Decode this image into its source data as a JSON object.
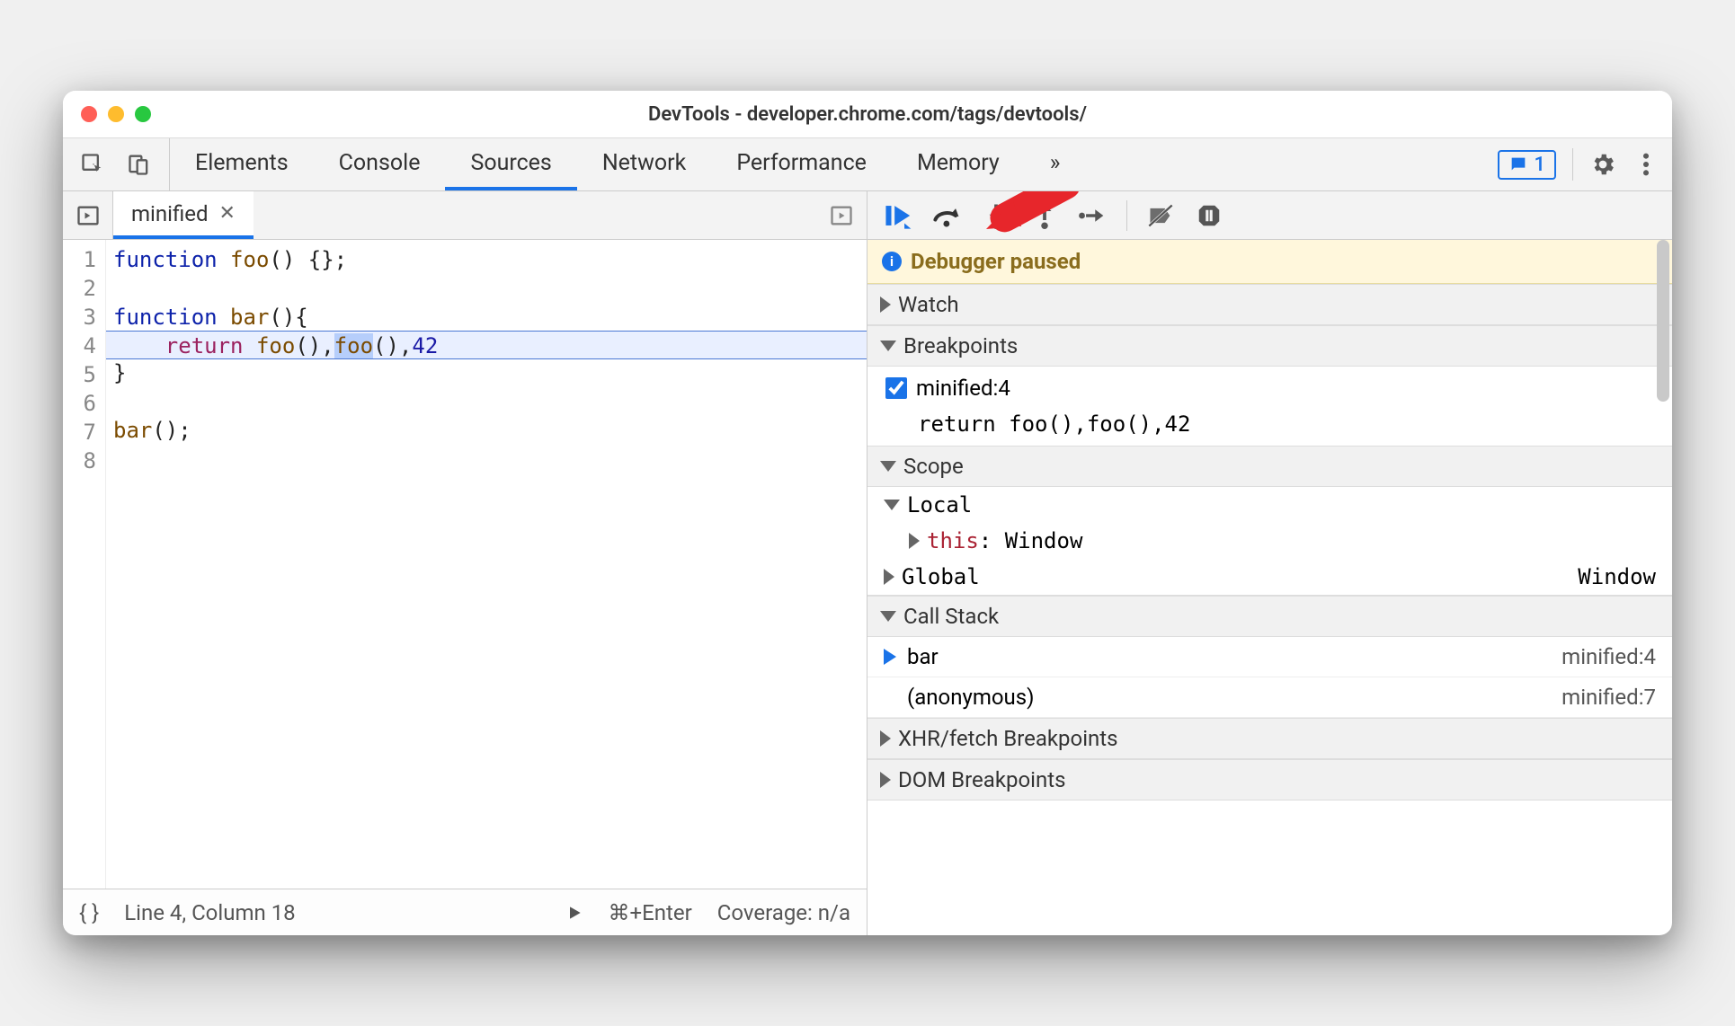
{
  "window": {
    "title": "DevTools - developer.chrome.com/tags/devtools/"
  },
  "toolbar": {
    "tabs": [
      "Elements",
      "Console",
      "Sources",
      "Network",
      "Performance",
      "Memory"
    ],
    "active_tab_index": 2,
    "issues_count": "1"
  },
  "source": {
    "open_file": "minified",
    "lines": [
      "function foo() {};",
      "",
      "function bar(){",
      "    return foo(),foo(),42",
      "}",
      "",
      "bar();",
      ""
    ],
    "highlighted_line_index": 3,
    "highlight_token": "foo",
    "highlight_token_occurrence": 2
  },
  "statusbar": {
    "braces": "{ }",
    "pos": "Line 4, Column 18",
    "shortcut": "⌘+Enter",
    "coverage": "Coverage: n/a"
  },
  "debugger": {
    "banner": "Debugger paused",
    "sections": {
      "watch": "Watch",
      "breakpoints": "Breakpoints",
      "scope": "Scope",
      "callstack": "Call Stack",
      "xhr": "XHR/fetch Breakpoints",
      "dom": "DOM Breakpoints"
    },
    "breakpoints": [
      {
        "checked": true,
        "label": "minified:4",
        "code": "return foo(),foo(),42"
      }
    ],
    "scope": {
      "local": {
        "label": "Local",
        "this_label": "this",
        "this_value": "Window"
      },
      "global": {
        "label": "Global",
        "value": "Window"
      }
    },
    "callstack": [
      {
        "fn": "bar",
        "loc": "minified:4",
        "current": true
      },
      {
        "fn": "(anonymous)",
        "loc": "minified:7",
        "current": false
      }
    ]
  }
}
